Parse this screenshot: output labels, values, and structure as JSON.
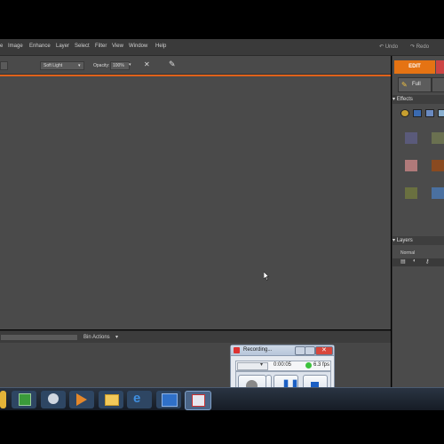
{
  "menubar": {
    "items": [
      "e",
      "Image",
      "Enhance",
      "Layer",
      "Select",
      "Filter",
      "View",
      "Window",
      "Help"
    ],
    "undo_label": "Undo",
    "redo_label": "Redo"
  },
  "options": {
    "blend_mode": "Soft Light",
    "opacity_label": "Opacity:",
    "opacity_value": "100%"
  },
  "bin": {
    "actions_label": "Bin Actions"
  },
  "right_panel": {
    "mode_tab": "EDIT",
    "full_tab": "Full",
    "effects_header": "Effects",
    "layers_header": "Layers",
    "blend_mode": "Normal",
    "swatch_colors": [
      "#5a5a7a",
      "#6a7050",
      "#b07a7a",
      "#8a4a20",
      "#6a7040",
      "#4a70a0"
    ]
  },
  "recording_widget": {
    "title": "Recording...",
    "timer": "0:00:05",
    "fps": "6.3 fps",
    "dropdown_value": ""
  },
  "colors": {
    "accent_orange": "#e57313",
    "canvas_gray": "#4a4a4a"
  }
}
